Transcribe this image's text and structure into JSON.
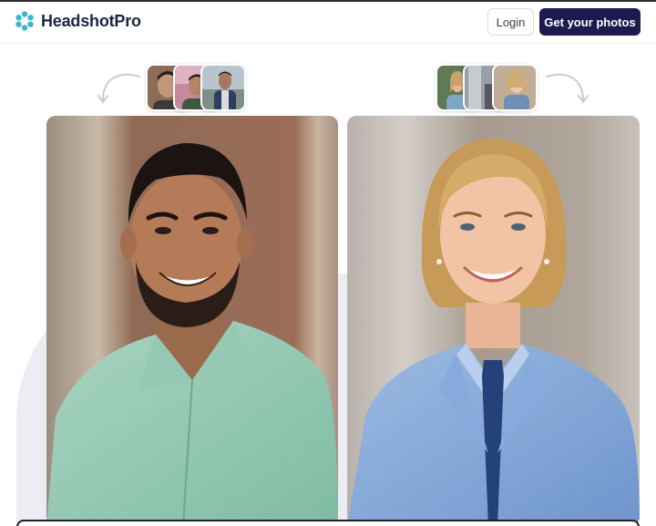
{
  "brand": {
    "name": "HeadshotPro",
    "logo_icon": "headshotpro-logo-icon",
    "accent": "#3fb7c4"
  },
  "header": {
    "login_label": "Login",
    "cta_label": "Get your photos",
    "cta_color": "#1d1a4f"
  },
  "examples": [
    {
      "subject": "man",
      "input_selfies": [
        "selfie-1",
        "selfie-2",
        "selfie-3"
      ],
      "output": "ai-headshot-man"
    },
    {
      "subject": "woman",
      "input_selfies": [
        "selfie-1",
        "selfie-2",
        "selfie-3"
      ],
      "output": "ai-headshot-woman"
    }
  ]
}
